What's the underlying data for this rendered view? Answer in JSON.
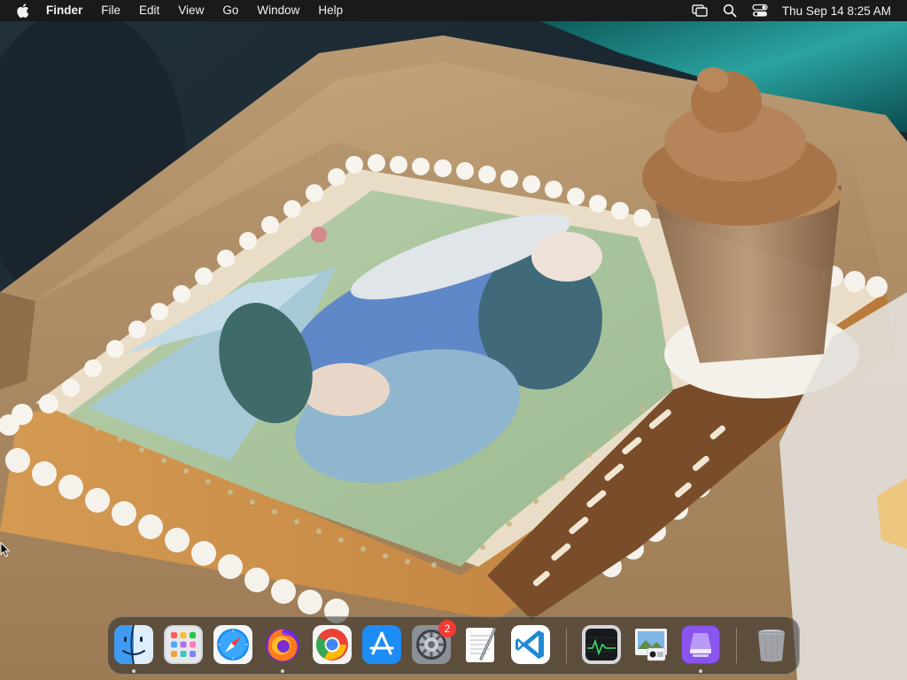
{
  "menubar": {
    "app_name": "Finder",
    "items": [
      "File",
      "Edit",
      "View",
      "Go",
      "Window",
      "Help"
    ],
    "clock": "Thu Sep 14  8:25 AM",
    "status_icons": [
      "screen-mirroring-icon",
      "spotlight-search-icon",
      "control-center-icon"
    ]
  },
  "wallpaper": {
    "description_icon": "birthday-cake-photo"
  },
  "dock": {
    "apps": [
      {
        "name": "Finder",
        "icon": "finder-icon",
        "running": true
      },
      {
        "name": "Launchpad",
        "icon": "launchpad-icon",
        "running": false
      },
      {
        "name": "Safari",
        "icon": "safari-icon",
        "running": false
      },
      {
        "name": "Firefox",
        "icon": "firefox-icon",
        "running": true
      },
      {
        "name": "Google Chrome",
        "icon": "chrome-icon",
        "running": false
      },
      {
        "name": "App Store",
        "icon": "app-store-icon",
        "running": false
      },
      {
        "name": "System Settings",
        "icon": "system-settings-icon",
        "running": false,
        "badge": "2"
      },
      {
        "name": "TextEdit",
        "icon": "textedit-icon",
        "running": false
      },
      {
        "name": "Visual Studio Code",
        "icon": "vscode-icon",
        "running": false
      },
      {
        "name": "Activity Monitor",
        "icon": "activity-monitor-icon",
        "running": false
      },
      {
        "name": "Preview",
        "icon": "preview-icon",
        "running": false
      },
      {
        "name": "Simulator",
        "icon": "simulator-icon",
        "running": true
      },
      {
        "name": "Trash",
        "icon": "trash-icon",
        "running": false
      }
    ]
  },
  "colors": {
    "menubar_bg": "#191919",
    "badge": "#ef3b33",
    "vscode_blue": "#1f8ad2",
    "safari_blue": "#1a8cf0"
  }
}
